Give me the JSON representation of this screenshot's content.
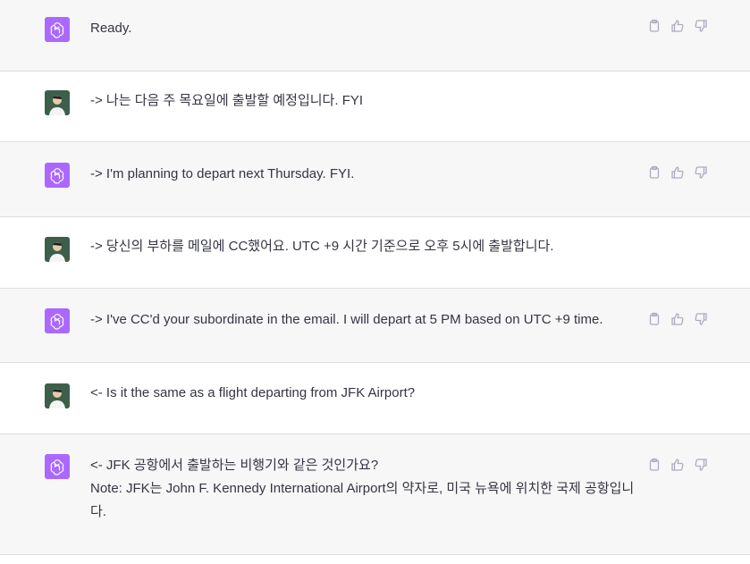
{
  "conversation": {
    "messages": [
      {
        "role": "assistant",
        "text": "Ready."
      },
      {
        "role": "user",
        "text": "-> 나는 다음 주 목요일에 출발할 예정입니다. FYI"
      },
      {
        "role": "assistant",
        "text": "-> I'm planning to depart next Thursday. FYI."
      },
      {
        "role": "user",
        "text": "-> 당신의 부하를 메일에 CC했어요. UTC +9 시간 기준으로 오후 5시에 출발합니다."
      },
      {
        "role": "assistant",
        "text": "-> I've CC'd your subordinate in the email. I will depart at 5 PM based on UTC +9 time."
      },
      {
        "role": "user",
        "text": "<- Is it the same as a flight departing from JFK Airport?"
      },
      {
        "role": "assistant",
        "text": "<- JFK 공항에서 출발하는 비행기와 같은 것인가요?\nNote: JFK는 John F. Kennedy International Airport의 약자로, 미국 뉴욕에 위치한 국제 공항입니다."
      }
    ]
  },
  "icons": {
    "assistant_avatar": "openai-logo-icon",
    "user_avatar": "user-photo-icon",
    "copy": "clipboard-icon",
    "like": "thumbs-up-icon",
    "dislike": "thumbs-down-icon"
  },
  "colors": {
    "assistant_bg": "#f7f7f8",
    "user_bg": "#ffffff",
    "assistant_avatar_bg": "#ab68ff",
    "text": "#343541",
    "icon": "#acacbe"
  }
}
